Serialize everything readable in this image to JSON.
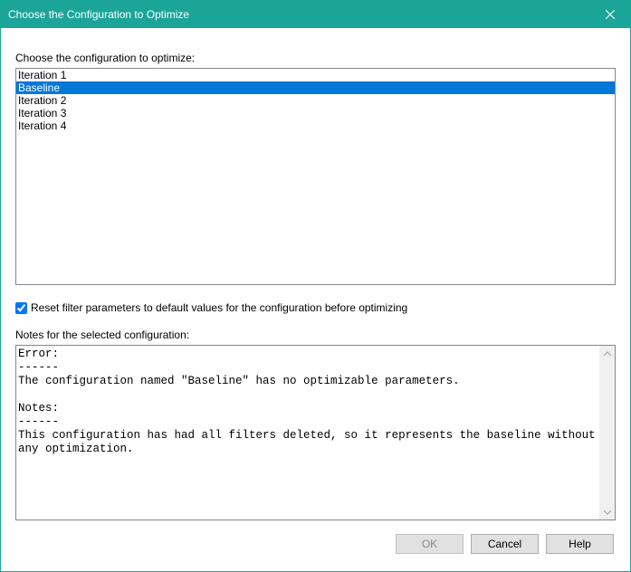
{
  "window": {
    "title": "Choose the Configuration to Optimize"
  },
  "labels": {
    "choose": "Choose the configuration to optimize:",
    "checkbox": "Reset filter parameters to default values for the configuration before optimizing",
    "notes": "Notes for the selected configuration:"
  },
  "list": {
    "items": [
      {
        "label": "Iteration 1",
        "selected": false
      },
      {
        "label": "Baseline",
        "selected": true
      },
      {
        "label": "Iteration 2",
        "selected": false
      },
      {
        "label": "Iteration 3",
        "selected": false
      },
      {
        "label": "Iteration 4",
        "selected": false
      }
    ]
  },
  "checkbox": {
    "checked": true
  },
  "notes_text": "Error:\n------\nThe configuration named \"Baseline\" has no optimizable parameters.\n\nNotes:\n------\nThis configuration has had all filters deleted, so it represents the baseline without any optimization.",
  "buttons": {
    "ok": "OK",
    "cancel": "Cancel",
    "help": "Help"
  }
}
